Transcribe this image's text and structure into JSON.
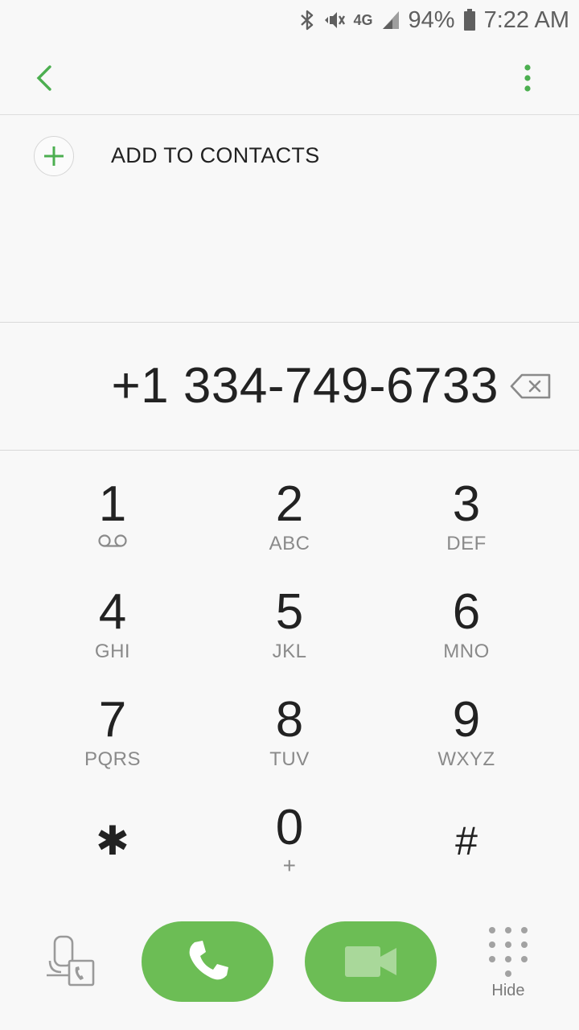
{
  "status_bar": {
    "network": "4G",
    "battery": "94%",
    "time": "7:22 AM",
    "icons": [
      "bluetooth-icon",
      "vibrate-icon",
      "network-4g-icon",
      "signal-icon",
      "battery-icon"
    ]
  },
  "toolbar": {
    "back_icon": "chevron-left-icon",
    "more_icon": "more-vertical-icon"
  },
  "add_contact": {
    "label": "ADD TO CONTACTS",
    "icon": "plus-icon"
  },
  "dialer": {
    "number": "+1 334-749-6733",
    "backspace_icon": "backspace-icon"
  },
  "keypad": [
    {
      "digit": "1",
      "letters": "",
      "icon": "voicemail-icon"
    },
    {
      "digit": "2",
      "letters": "ABC"
    },
    {
      "digit": "3",
      "letters": "DEF"
    },
    {
      "digit": "4",
      "letters": "GHI"
    },
    {
      "digit": "5",
      "letters": "JKL"
    },
    {
      "digit": "6",
      "letters": "MNO"
    },
    {
      "digit": "7",
      "letters": "PQRS"
    },
    {
      "digit": "8",
      "letters": "TUV"
    },
    {
      "digit": "9",
      "letters": "WXYZ"
    },
    {
      "digit": "✱",
      "letters": ""
    },
    {
      "digit": "0",
      "letters": "+"
    },
    {
      "digit": "#",
      "letters": ""
    }
  ],
  "bottom_bar": {
    "hide_label": "Hide",
    "call_icon": "phone-icon",
    "video_icon": "video-call-icon",
    "share_icon": "phone-switch-icon"
  },
  "colors": {
    "accent": "#6cbd55",
    "icon_green": "#4caf50"
  }
}
